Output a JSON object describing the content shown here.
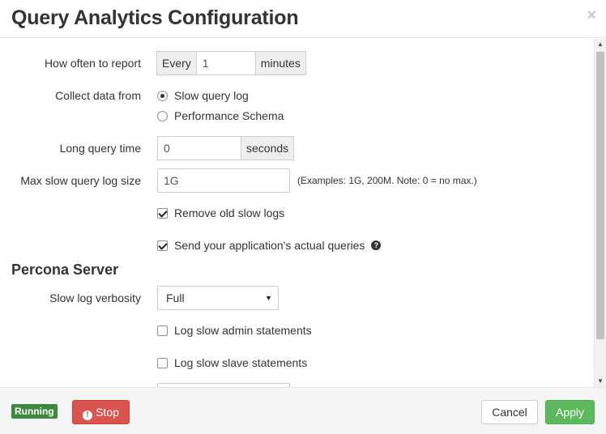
{
  "dialog": {
    "title": "Query Analytics Configuration",
    "close_label": "×"
  },
  "form": {
    "report": {
      "label": "How often to report",
      "prefix": "Every",
      "value": "1",
      "suffix": "minutes"
    },
    "collect": {
      "label": "Collect data from",
      "options": [
        "Slow query log",
        "Performance Schema"
      ],
      "selected": "Slow query log"
    },
    "long_query_time": {
      "label": "Long query time",
      "value": "0",
      "suffix": "seconds"
    },
    "max_slow_log_size": {
      "label": "Max slow query log size",
      "value": "1G",
      "hint": "(Examples: 1G, 200M. Note: 0 = no max.)"
    },
    "remove_old_logs": {
      "label": "Remove old slow logs",
      "checked": true
    },
    "send_queries": {
      "label": "Send your application's actual queries",
      "checked": true,
      "help_icon": "question-circle-icon"
    }
  },
  "percona": {
    "title": "Percona Server",
    "verbosity": {
      "label": "Slow log verbosity",
      "value": "Full"
    },
    "log_admin": {
      "label": "Log slow admin statements",
      "checked": false
    },
    "log_slave": {
      "label": "Log slow slave statements",
      "checked": false
    }
  },
  "footer": {
    "status": "Running",
    "stop_label": "Stop",
    "cancel_label": "Cancel",
    "apply_label": "Apply"
  },
  "colors": {
    "running": "#3c8a3c",
    "stop": "#d9534f",
    "apply": "#5cb85c"
  }
}
